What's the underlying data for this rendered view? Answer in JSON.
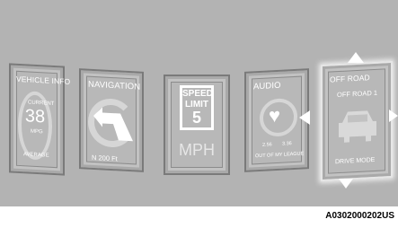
{
  "screens": {
    "vehicle_info": {
      "title": "VEHICLE INFO",
      "sub": "CURRENT",
      "value": "38",
      "unit": "MPG",
      "footer": "AVERAGE"
    },
    "navigation": {
      "title": "NAVIGATION",
      "distance": "N 200 Ft"
    },
    "speed_limit": {
      "line1": "SPEED",
      "line2": "LIMIT",
      "value": "5",
      "unit": "MPH"
    },
    "audio": {
      "title": "AUDIO",
      "time_elapsed": "2.56",
      "time_total": "3.36",
      "song": "OUT OF MY LEAGUE"
    },
    "off_road": {
      "title": "OFF ROAD",
      "subtitle": "OFF ROAD 1",
      "footer": "DRIVE MODE"
    }
  },
  "figure_code": "A0302000202US"
}
